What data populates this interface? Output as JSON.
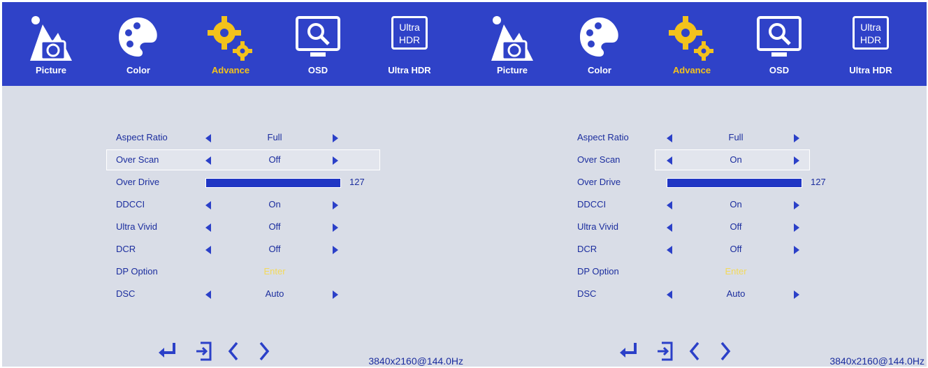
{
  "tabs": [
    {
      "label": "Picture",
      "icon": "mountain-camera-icon"
    },
    {
      "label": "Color",
      "icon": "palette-icon"
    },
    {
      "label": "Advance",
      "icon": "gears-icon"
    },
    {
      "label": "OSD",
      "icon": "monitor-magnifier-icon"
    },
    {
      "label": "Ultra HDR",
      "icon": "ultra-hdr-icon",
      "icon_text": "Ultra HDR"
    }
  ],
  "selected_tab": "Advance",
  "colors": {
    "header": "#2f42c8",
    "selected_tab": "#f3c21c",
    "panel_bg": "#d9dde7",
    "menu_text": "#1b2d9e"
  },
  "panels": [
    {
      "rows": [
        {
          "label": "Aspect Ratio",
          "value": "Full"
        },
        {
          "label": "Over Scan",
          "value": "Off"
        },
        {
          "label": "Over Drive",
          "value": "127"
        },
        {
          "label": "DDCCI",
          "value": "On"
        },
        {
          "label": "Ultra Vivid",
          "value": "Off"
        },
        {
          "label": "DCR",
          "value": "Off"
        },
        {
          "label": "DP Option",
          "value": "Enter"
        },
        {
          "label": "DSC",
          "value": "Auto"
        }
      ],
      "highlighted": "Over Scan",
      "resolution": "3840x2160@144.0Hz"
    },
    {
      "rows": [
        {
          "label": "Aspect Ratio",
          "value": "Full"
        },
        {
          "label": "Over Scan",
          "value": "On"
        },
        {
          "label": "Over Drive",
          "value": "127"
        },
        {
          "label": "DDCCI",
          "value": "On"
        },
        {
          "label": "Ultra Vivid",
          "value": "Off"
        },
        {
          "label": "DCR",
          "value": "Off"
        },
        {
          "label": "DP Option",
          "value": "Enter"
        },
        {
          "label": "DSC",
          "value": "Auto"
        }
      ],
      "highlighted": "Over Scan",
      "resolution": "3840x2160@144.0Hz"
    }
  ],
  "bottom_icons": [
    "enter-icon",
    "exit-icon",
    "left-arrow-icon",
    "right-arrow-icon"
  ]
}
